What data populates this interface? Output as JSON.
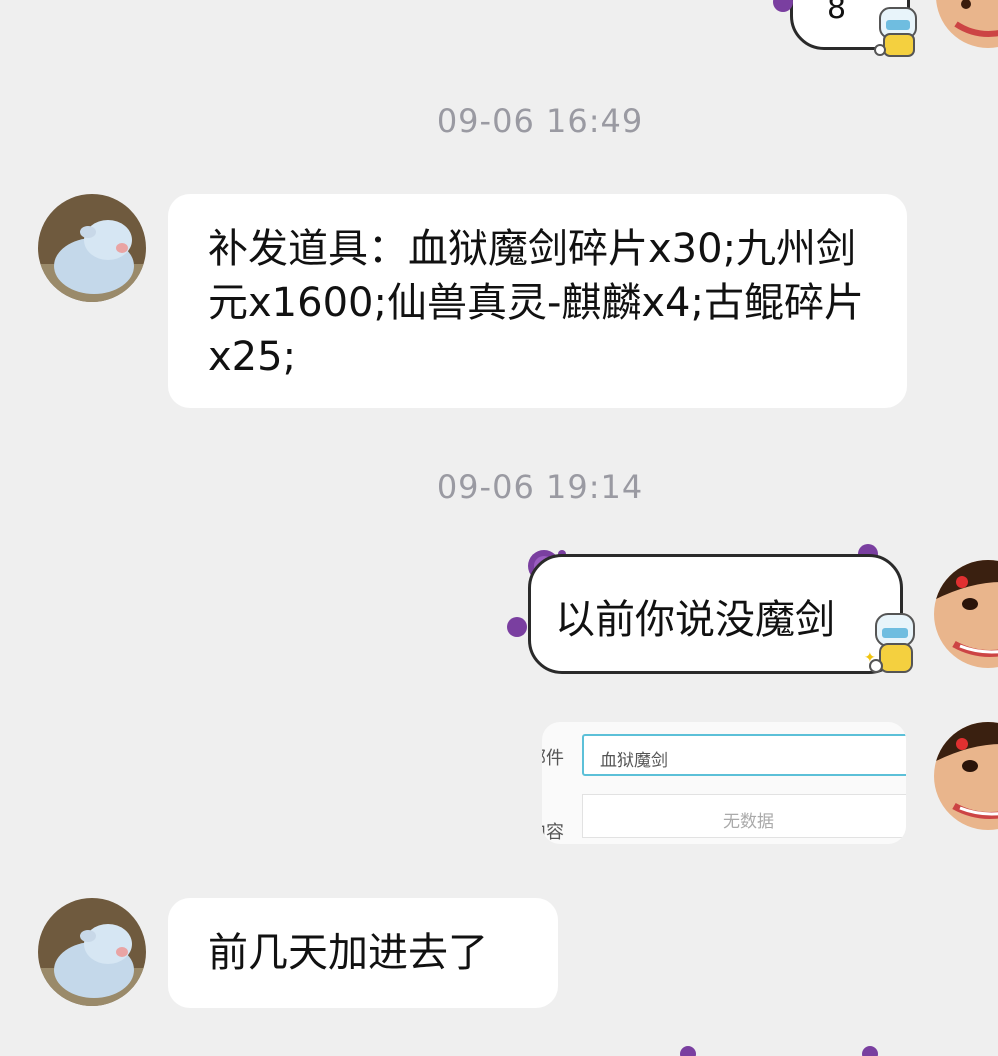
{
  "messages": [
    {
      "timestamp": "09-06 16:49"
    },
    {
      "text": "补发道具：血狱魔剑碎片x30;九州剑元x1600;仙兽真灵-麒麟x4;古鲲碎片x25;"
    },
    {
      "timestamp": "09-06 19:14"
    },
    {
      "text": "以前你说没魔剑"
    },
    {
      "image": {
        "field_label_1": "邮件",
        "field_value": "血狱魔剑",
        "field_label_2": "内容",
        "empty_text": "无数据"
      }
    },
    {
      "text": "前几天加进去了"
    }
  ],
  "colors": {
    "background": "#efefef",
    "bubble": "#ffffff",
    "timestamp": "#9a9aa2",
    "virus": "#7a3fa0",
    "input_border": "#5cc0d8"
  },
  "icons": [
    "lamb-avatar",
    "child-avatar",
    "virus-sticker-icon",
    "doctor-sticker-icon"
  ]
}
